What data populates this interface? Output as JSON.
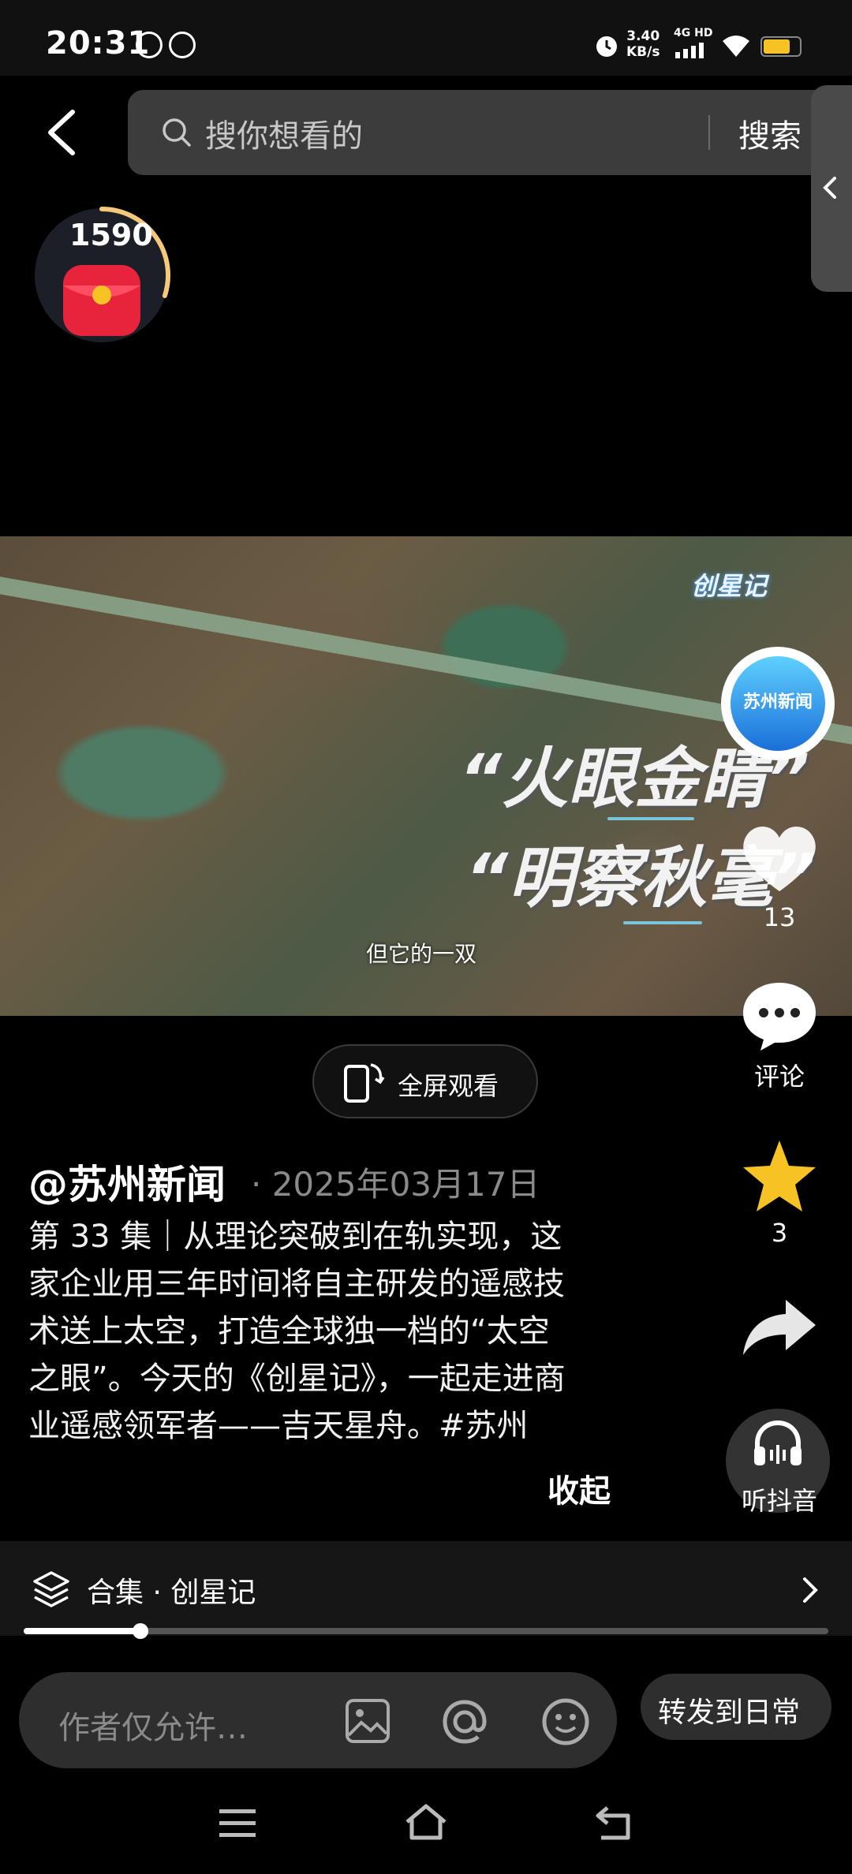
{
  "status_bar": {
    "time": "20:31",
    "net_speed": "3.40",
    "net_speed_unit": "KB/s",
    "net_type": "4G HD",
    "battery_percent": 75,
    "icons": [
      "notification-icon-1",
      "notification-icon-2",
      "alarm-icon",
      "signal-icon",
      "wifi-icon",
      "battery-icon"
    ]
  },
  "search": {
    "placeholder": "搜你想看的",
    "button_label": "搜索"
  },
  "coin_widget": {
    "count": "1590",
    "progress_fraction": 0.3
  },
  "video": {
    "brand_overlay": "创星记",
    "title_line1": "“火眼金睛”",
    "title_line2": "“明察秋毫”",
    "subtitle": "但它的一双",
    "author_avatar_text": "苏州新闻"
  },
  "actions": {
    "like_count": "13",
    "comment_label": "评论",
    "favorite_count": "3",
    "listen_label": "听抖音"
  },
  "fullscreen_label": "全屏观看",
  "post": {
    "author": "@苏州新闻",
    "date": "· 2025年03月17日",
    "description_lines": [
      "第 33 集｜从理论突破到在轨实现，这",
      "家企业用三年时间将自主研发的遥感技",
      "术送上太空，打造全球独一档的“太空",
      "之眼”。今天的《创星记》，一起走进商",
      "业遥感领军者——吉天星舟。#苏州"
    ],
    "collapse_label": "收起"
  },
  "collection": {
    "label": "合集 · 创星记",
    "progress_fraction": 0.145
  },
  "comment_bar": {
    "placeholder": "作者仅允许…",
    "repost_label": "转发到日常"
  },
  "colors": {
    "background": "#000000",
    "favorite_star": "#f7c324",
    "battery": "#f7c324",
    "coin_gift": "#e8243c"
  }
}
